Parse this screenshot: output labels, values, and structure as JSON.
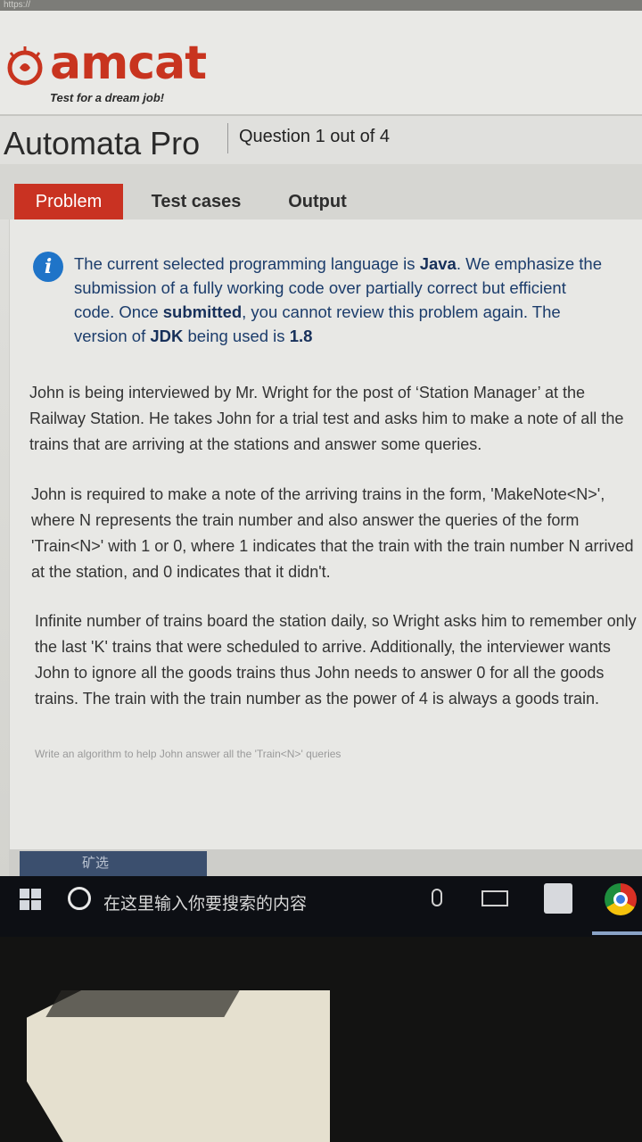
{
  "browser": {
    "url_fragment": "https://"
  },
  "brand": {
    "name": "amcat",
    "tagline": "Test for a dream job!",
    "color": "#c8341f"
  },
  "test": {
    "product": "Automata Pro",
    "question_count": "Question 1 out of 4"
  },
  "tabs": [
    {
      "label": "Problem",
      "active": true
    },
    {
      "label": "Test cases",
      "active": false
    },
    {
      "label": "Output",
      "active": false
    }
  ],
  "notice": {
    "s1": "The current selected programming language is ",
    "lang": "Java",
    "s2": ". We emphasize the submission of a fully working code over partially correct but efficient code. Once ",
    "submitted": "submitted",
    "s3": ", you cannot review this problem again. The version of ",
    "jdk": "JDK",
    "s4": " being used is ",
    "version": "1.8"
  },
  "problem": {
    "p1": "John is being interviewed by Mr. Wright for the post of ‘Station Manager’ at the Railway Station. He takes John for a trial test and asks him to make a note of all the trains that are arriving at the stations and answer some queries.",
    "p2": "John is required to make a note of the arriving trains in the form, 'MakeNote<N>', where N represents the train number and also answer the queries of the form 'Train<N>' with 1 or 0, where 1 indicates that the train with the train number N arrived at the station, and 0 indicates that it didn't.",
    "p3": "Infinite number of trains board the station daily, so Wright asks him to remember only the last 'K' trains that were scheduled to arrive. Additionally, the interviewer wants John to ignore all the goods trains thus John needs to answer 0 for all the goods trains. The train with the train number as the power of 4 is always a goods train.",
    "p4": "Write an algorithm to help John answer all the 'Train<N>' queries"
  },
  "thumbnail": {
    "label": "矿选"
  },
  "taskbar": {
    "search_placeholder": "在这里输入你要搜索的内容"
  }
}
